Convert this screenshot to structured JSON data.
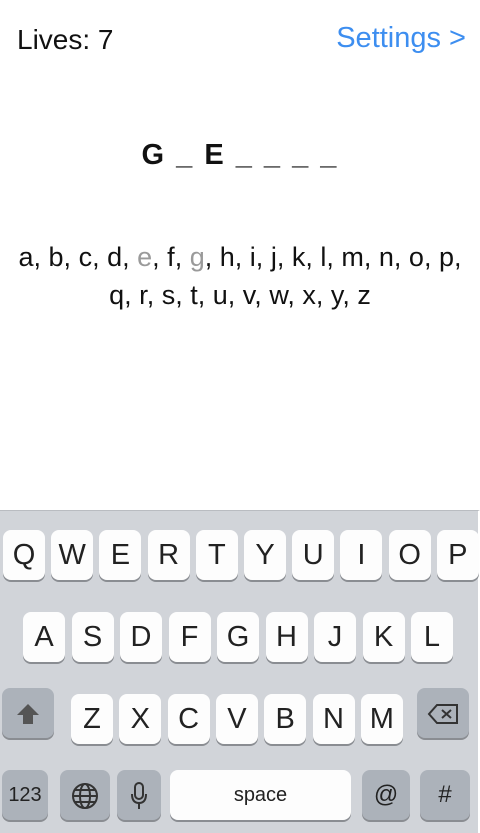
{
  "header": {
    "lives_text": "Lives: 7",
    "settings_label": "Settings >"
  },
  "game": {
    "word_display": "G _ E _ _ _ _",
    "letters": [
      {
        "letter": "a",
        "used": false
      },
      {
        "letter": "b",
        "used": false
      },
      {
        "letter": "c",
        "used": false
      },
      {
        "letter": "d",
        "used": false
      },
      {
        "letter": "e",
        "used": true
      },
      {
        "letter": "f",
        "used": false
      },
      {
        "letter": "g",
        "used": true
      },
      {
        "letter": "h",
        "used": false
      },
      {
        "letter": "i",
        "used": false
      },
      {
        "letter": "j",
        "used": false
      },
      {
        "letter": "k",
        "used": false
      },
      {
        "letter": "l",
        "used": false
      },
      {
        "letter": "m",
        "used": false
      },
      {
        "letter": "n",
        "used": false
      },
      {
        "letter": "o",
        "used": false
      },
      {
        "letter": "p",
        "used": false
      },
      {
        "letter": "q",
        "used": false
      },
      {
        "letter": "r",
        "used": false
      },
      {
        "letter": "s",
        "used": false
      },
      {
        "letter": "t",
        "used": false
      },
      {
        "letter": "u",
        "used": false
      },
      {
        "letter": "v",
        "used": false
      },
      {
        "letter": "w",
        "used": false
      },
      {
        "letter": "x",
        "used": false
      },
      {
        "letter": "y",
        "used": false
      },
      {
        "letter": "z",
        "used": false
      }
    ]
  },
  "keyboard": {
    "row1": [
      "Q",
      "W",
      "E",
      "R",
      "T",
      "Y",
      "U",
      "I",
      "O",
      "P"
    ],
    "row2": [
      "A",
      "S",
      "D",
      "F",
      "G",
      "H",
      "J",
      "K",
      "L"
    ],
    "row3": [
      "Z",
      "X",
      "C",
      "V",
      "B",
      "N",
      "M"
    ],
    "numbers_label": "123",
    "space_label": "space",
    "at_label": "@",
    "hash_label": "#",
    "icons": {
      "shift": "shift-icon",
      "delete": "backspace-icon",
      "globe": "globe-icon",
      "mic": "microphone-icon"
    }
  },
  "colors": {
    "accent": "#3d8ef0",
    "used_letter": "#9a9a9a",
    "keyboard_bg": "#d1d4d9",
    "key_bg": "#fdfdfd",
    "dark_key_bg": "#acb2ba"
  }
}
